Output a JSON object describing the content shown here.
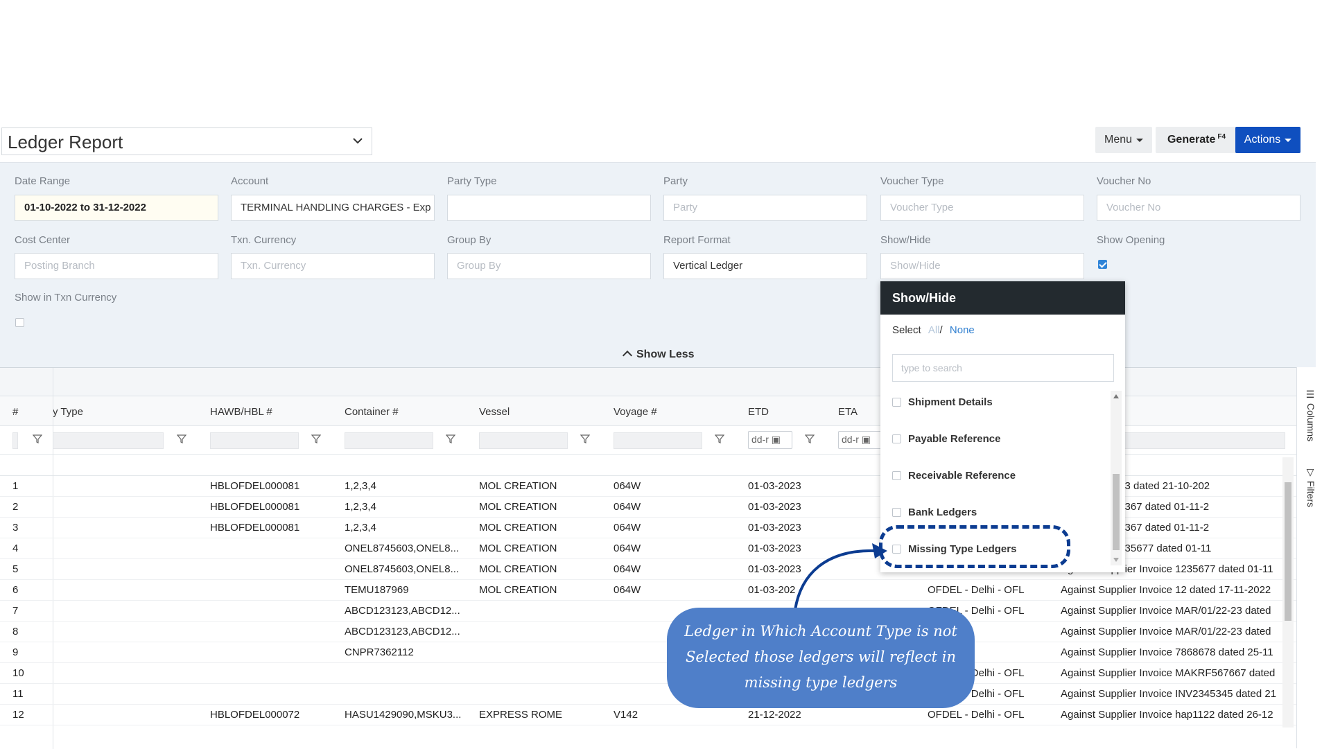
{
  "header": {
    "report_title": "Ledger Report",
    "menu_label": "Menu",
    "generate_label": "Generate",
    "generate_shortcut": "F4",
    "actions_label": "Actions"
  },
  "filters": {
    "date_range": {
      "label": "Date Range",
      "value": "01-10-2022 to 31-12-2022"
    },
    "account": {
      "label": "Account",
      "value": "TERMINAL HANDLING CHARGES - Exp"
    },
    "party_type": {
      "label": "Party Type",
      "value": ""
    },
    "party": {
      "label": "Party",
      "placeholder": "Party"
    },
    "voucher_type": {
      "label": "Voucher Type",
      "placeholder": "Voucher Type"
    },
    "voucher_no": {
      "label": "Voucher No",
      "placeholder": "Voucher No"
    },
    "cost_center": {
      "label": "Cost Center",
      "placeholder": "Posting Branch"
    },
    "txn_currency": {
      "label": "Txn. Currency",
      "placeholder": "Txn. Currency"
    },
    "group_by": {
      "label": "Group By",
      "placeholder": "Group By"
    },
    "report_format": {
      "label": "Report Format",
      "value": "Vertical Ledger"
    },
    "show_hide": {
      "label": "Show/Hide",
      "placeholder": "Show/Hide"
    },
    "show_opening": {
      "label": "Show Opening",
      "checked": true
    },
    "show_in_txn_currency": {
      "label": "Show in Txn Currency",
      "checked": false
    },
    "show_less_label": "Show Less"
  },
  "grid": {
    "columns": [
      "#",
      "y Type",
      "HAWB/HBL #",
      "Container #",
      "Vessel",
      "Voyage #",
      "ETD",
      "ETA"
    ],
    "date_placeholder": "dd-r",
    "rows": [
      {
        "n": "1",
        "hbl": "HBLOFDEL000081",
        "container": "1,2,3,4",
        "vessel": "MOL CREATION",
        "voyage": "064W",
        "etd": "01-03-2023",
        "branch": "",
        "narration": "lier Invoice 123 dated 21-10-202"
      },
      {
        "n": "2",
        "hbl": "HBLOFDEL000081",
        "container": "1,2,3,4",
        "vessel": "MOL CREATION",
        "voyage": "064W",
        "etd": "01-03-2023",
        "branch": "",
        "narration": "lier Invoice 12367 dated 01-11-2"
      },
      {
        "n": "3",
        "hbl": "HBLOFDEL000081",
        "container": "1,2,3,4",
        "vessel": "MOL CREATION",
        "voyage": "064W",
        "etd": "01-03-2023",
        "branch": "",
        "narration": "lier Invoice 12367 dated 01-11-2"
      },
      {
        "n": "4",
        "hbl": "",
        "container": "ONEL8745603,ONEL8...",
        "vessel": "MOL CREATION",
        "voyage": "064W",
        "etd": "01-03-2023",
        "branch": "",
        "narration": "lier Invoice 1235677 dated 01-11"
      },
      {
        "n": "5",
        "hbl": "",
        "container": "ONEL8745603,ONEL8...",
        "vessel": "MOL CREATION",
        "voyage": "064W",
        "etd": "01-03-2023",
        "branch": "",
        "narration": "Against Supplier Invoice 1235677 dated 01-11"
      },
      {
        "n": "6",
        "hbl": "",
        "container": "TEMU187969",
        "vessel": "MOL CREATION",
        "voyage": "064W",
        "etd": "01-03-202",
        "branch": "OFDEL - Delhi - OFL",
        "narration": "Against Supplier Invoice 12 dated 17-11-2022"
      },
      {
        "n": "7",
        "hbl": "",
        "container": "ABCD123123,ABCD12...",
        "vessel": "",
        "voyage": "",
        "etd": "",
        "branch": "OFDEL - Delhi - OFL",
        "narration": "Against Supplier Invoice MAR/01/22-23 dated"
      },
      {
        "n": "8",
        "hbl": "",
        "container": "ABCD123123,ABCD12...",
        "vessel": "",
        "voyage": "",
        "etd": "",
        "branch": "elhi - OFL",
        "narration": "Against Supplier Invoice MAR/01/22-23 dated"
      },
      {
        "n": "9",
        "hbl": "",
        "container": "CNPR7362112",
        "vessel": "",
        "voyage": "",
        "etd": "",
        "branch": "elhi - OFL",
        "narration": "Against Supplier Invoice 7868678 dated 25-11"
      },
      {
        "n": "10",
        "hbl": "",
        "container": "",
        "vessel": "",
        "voyage": "",
        "etd": "",
        "branch": "OFDEL - Delhi - OFL",
        "narration": "Against Supplier Invoice MAKRF567667 dated"
      },
      {
        "n": "11",
        "hbl": "",
        "container": "",
        "vessel": "",
        "voyage": "",
        "etd": "",
        "branch": "OFDEL - Delhi - OFL",
        "narration": "Against Supplier Invoice INV2345345 dated 21"
      },
      {
        "n": "12",
        "hbl": "HBLOFDEL000072",
        "container": "HASU1429090,MSKU3...",
        "vessel": "EXPRESS ROME",
        "voyage": "V142",
        "etd": "21-12-2022",
        "branch": "OFDEL - Delhi - OFL",
        "narration": "Against Supplier Invoice hap1122 dated 26-12"
      }
    ]
  },
  "side_tabs": {
    "columns": "Columns",
    "filters": "Filters"
  },
  "show_hide_panel": {
    "title": "Show/Hide",
    "select_label": "Select",
    "all_label": "All",
    "separator": "/",
    "none_label": "None",
    "search_placeholder": "type to search",
    "items": [
      {
        "label": "Shipment Details",
        "checked": false
      },
      {
        "label": "Payable Reference",
        "checked": false
      },
      {
        "label": "Receivable Reference",
        "checked": false
      },
      {
        "label": "Bank Ledgers",
        "checked": false
      },
      {
        "label": "Missing Type Ledgers",
        "checked": false
      }
    ]
  },
  "annotation": {
    "line1": "Ledger in Which Account Type is not",
    "line2": "Selected those ledgers will reflect in",
    "line3": "missing type ledgers"
  },
  "colors": {
    "accent": "#0f4fbf",
    "callout_bg": "#4f7fc9",
    "panel_header": "#232a2f",
    "filter_bg": "#edf2f7"
  }
}
